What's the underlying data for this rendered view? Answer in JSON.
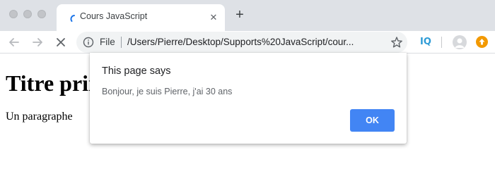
{
  "tab": {
    "title": "Cours JavaScript",
    "close_glyph": "✕"
  },
  "new_tab_glyph": "+",
  "omnibox": {
    "scheme": "File",
    "url": "/Users/Pierre/Desktop/Supports%20JavaScript/cour..."
  },
  "extension": {
    "label": "IQ"
  },
  "page": {
    "heading": "Titre principal",
    "paragraph": "Un paragraphe"
  },
  "dialog": {
    "title": "This page says",
    "message": "Bonjour, je suis Pierre, j'ai 30 ans",
    "ok_label": "OK"
  },
  "colors": {
    "tabstrip_bg": "#dee1e6",
    "accent_button": "#4285f4",
    "extension_iq": "#2d9bd6",
    "update_badge": "#f29900"
  }
}
